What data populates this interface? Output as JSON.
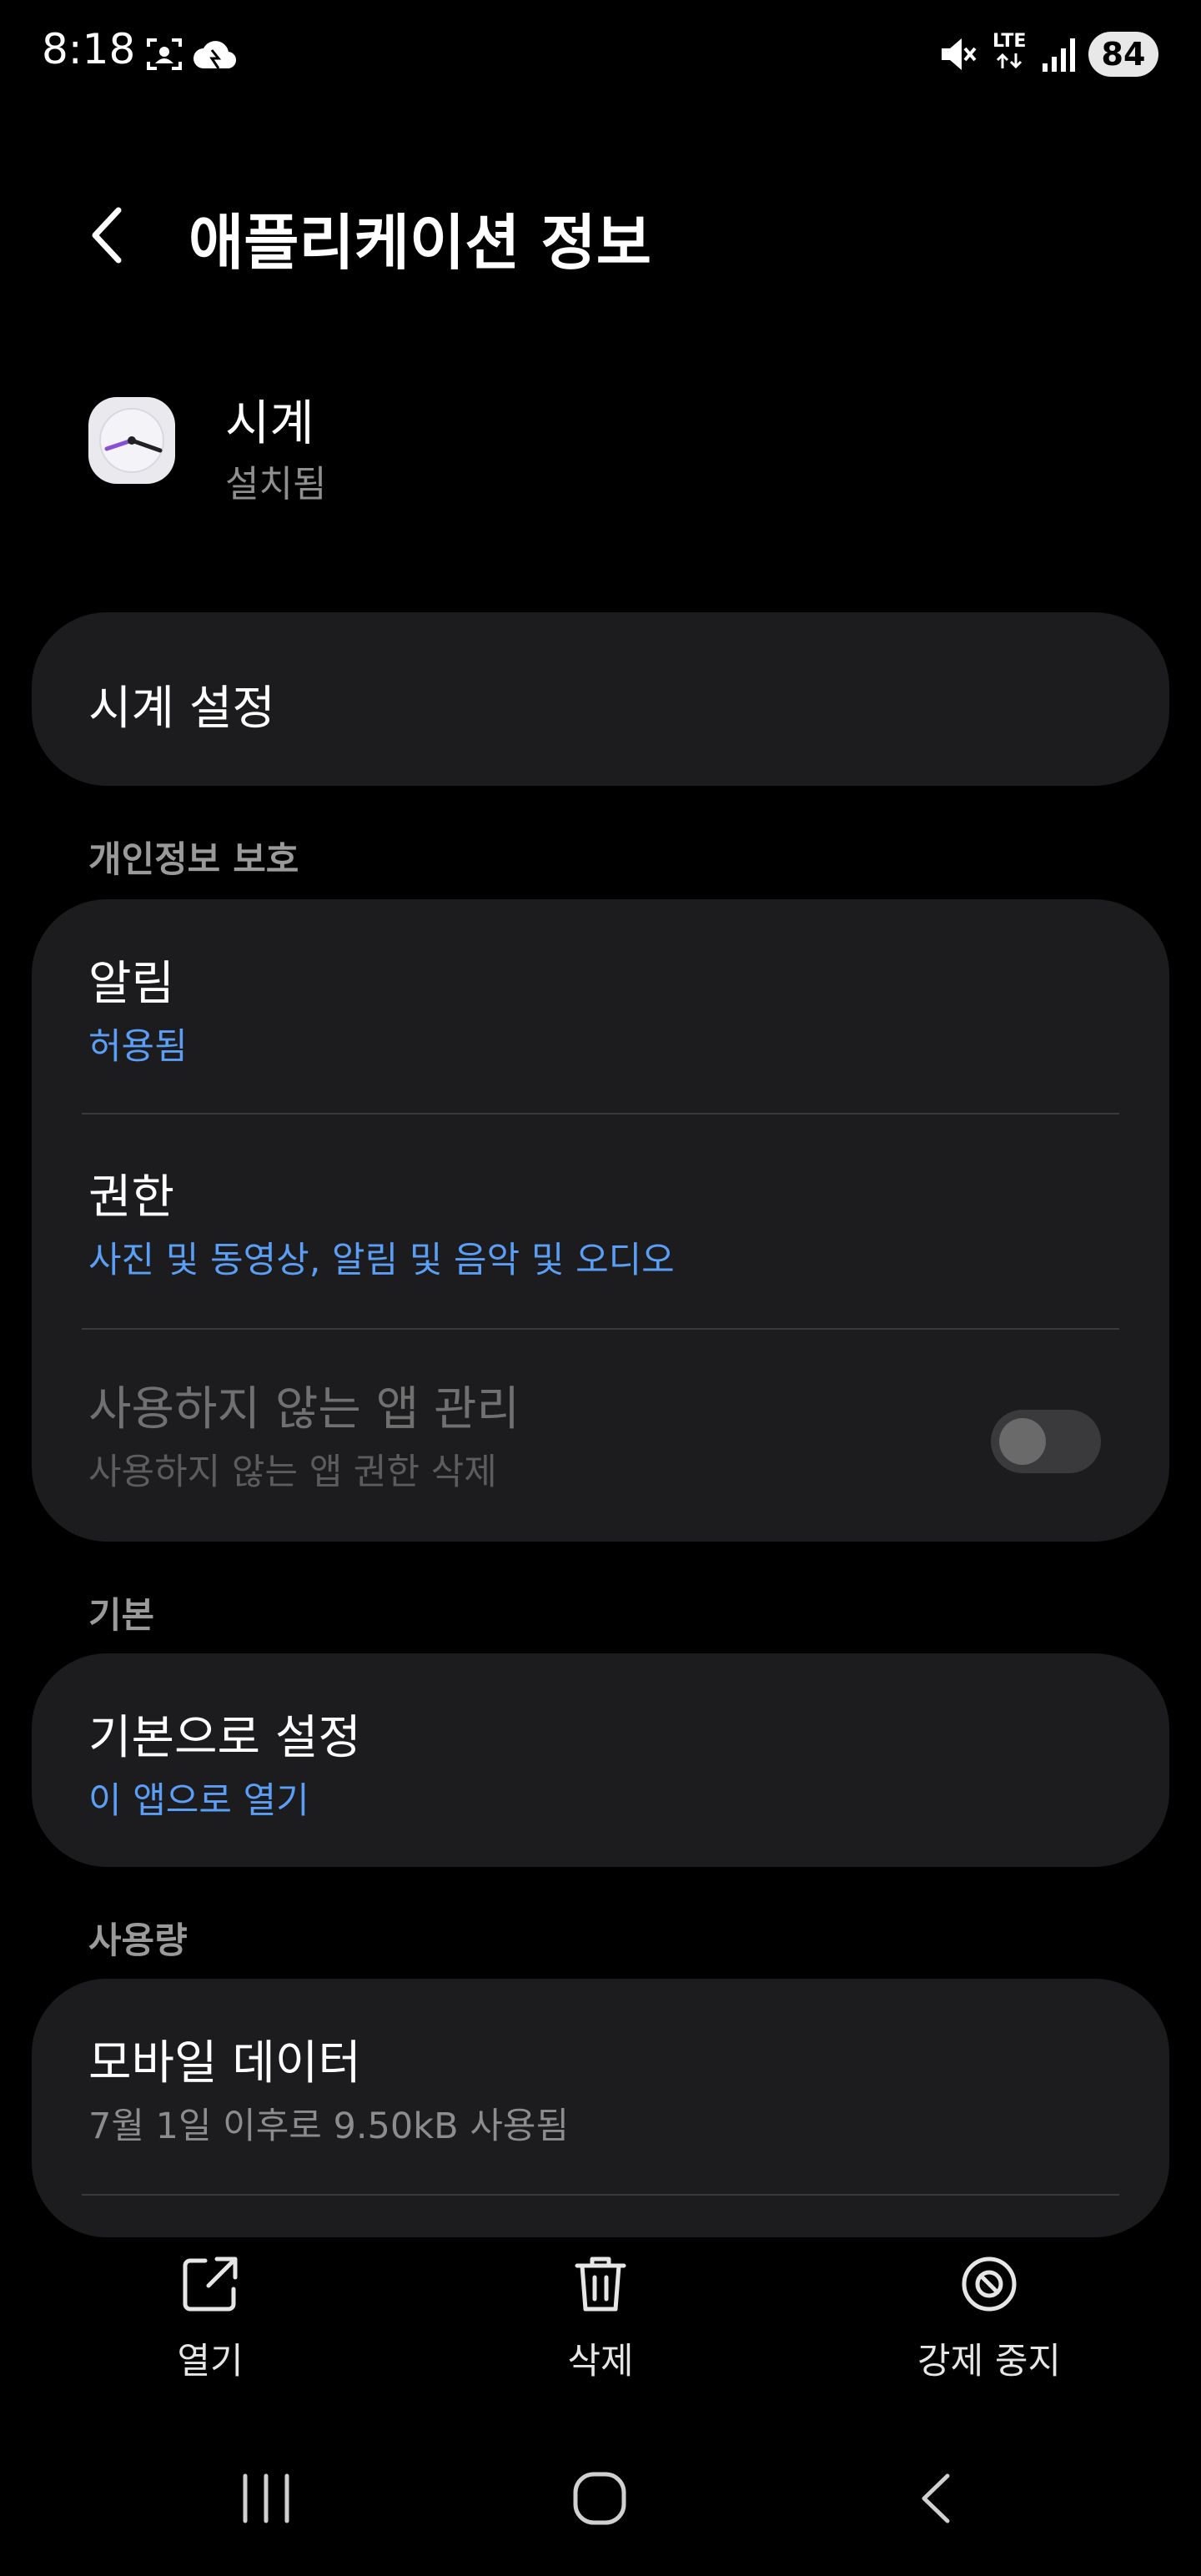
{
  "status_bar": {
    "time": "8:18",
    "battery": "84",
    "network": "LTE",
    "icons": [
      "screenshot-icon",
      "cloud-icon",
      "mute-icon",
      "data-arrows-icon",
      "signal-icon"
    ]
  },
  "header": {
    "title": "애플리케이션 정보"
  },
  "app": {
    "name": "시계",
    "status": "설치됨",
    "icon": "clock-app-icon"
  },
  "settings_card": {
    "label": "시계 설정"
  },
  "privacy": {
    "section_label": "개인정보 보호",
    "notifications": {
      "title": "알림",
      "value": "허용됨"
    },
    "permissions": {
      "title": "권한",
      "value": "사진 및 동영상, 알림 및 음악 및 오디오"
    },
    "unused_apps": {
      "title": "사용하지 않는 앱 관리",
      "subtitle": "사용하지 않는 앱 권한 삭제",
      "enabled": false
    }
  },
  "defaults": {
    "section_label": "기본",
    "set_default": {
      "title": "기본으로 설정",
      "value": "이 앱으로 열기"
    }
  },
  "usage": {
    "section_label": "사용량",
    "mobile_data": {
      "title": "모바일 데이터",
      "value": "7월 1일 이후로 9.50kB 사용됨"
    }
  },
  "actions": {
    "open": "열기",
    "uninstall": "삭제",
    "force_stop": "강제 중지"
  },
  "colors": {
    "background": "#000000",
    "card": "#1c1c1e",
    "accent": "#5a9ef5"
  }
}
